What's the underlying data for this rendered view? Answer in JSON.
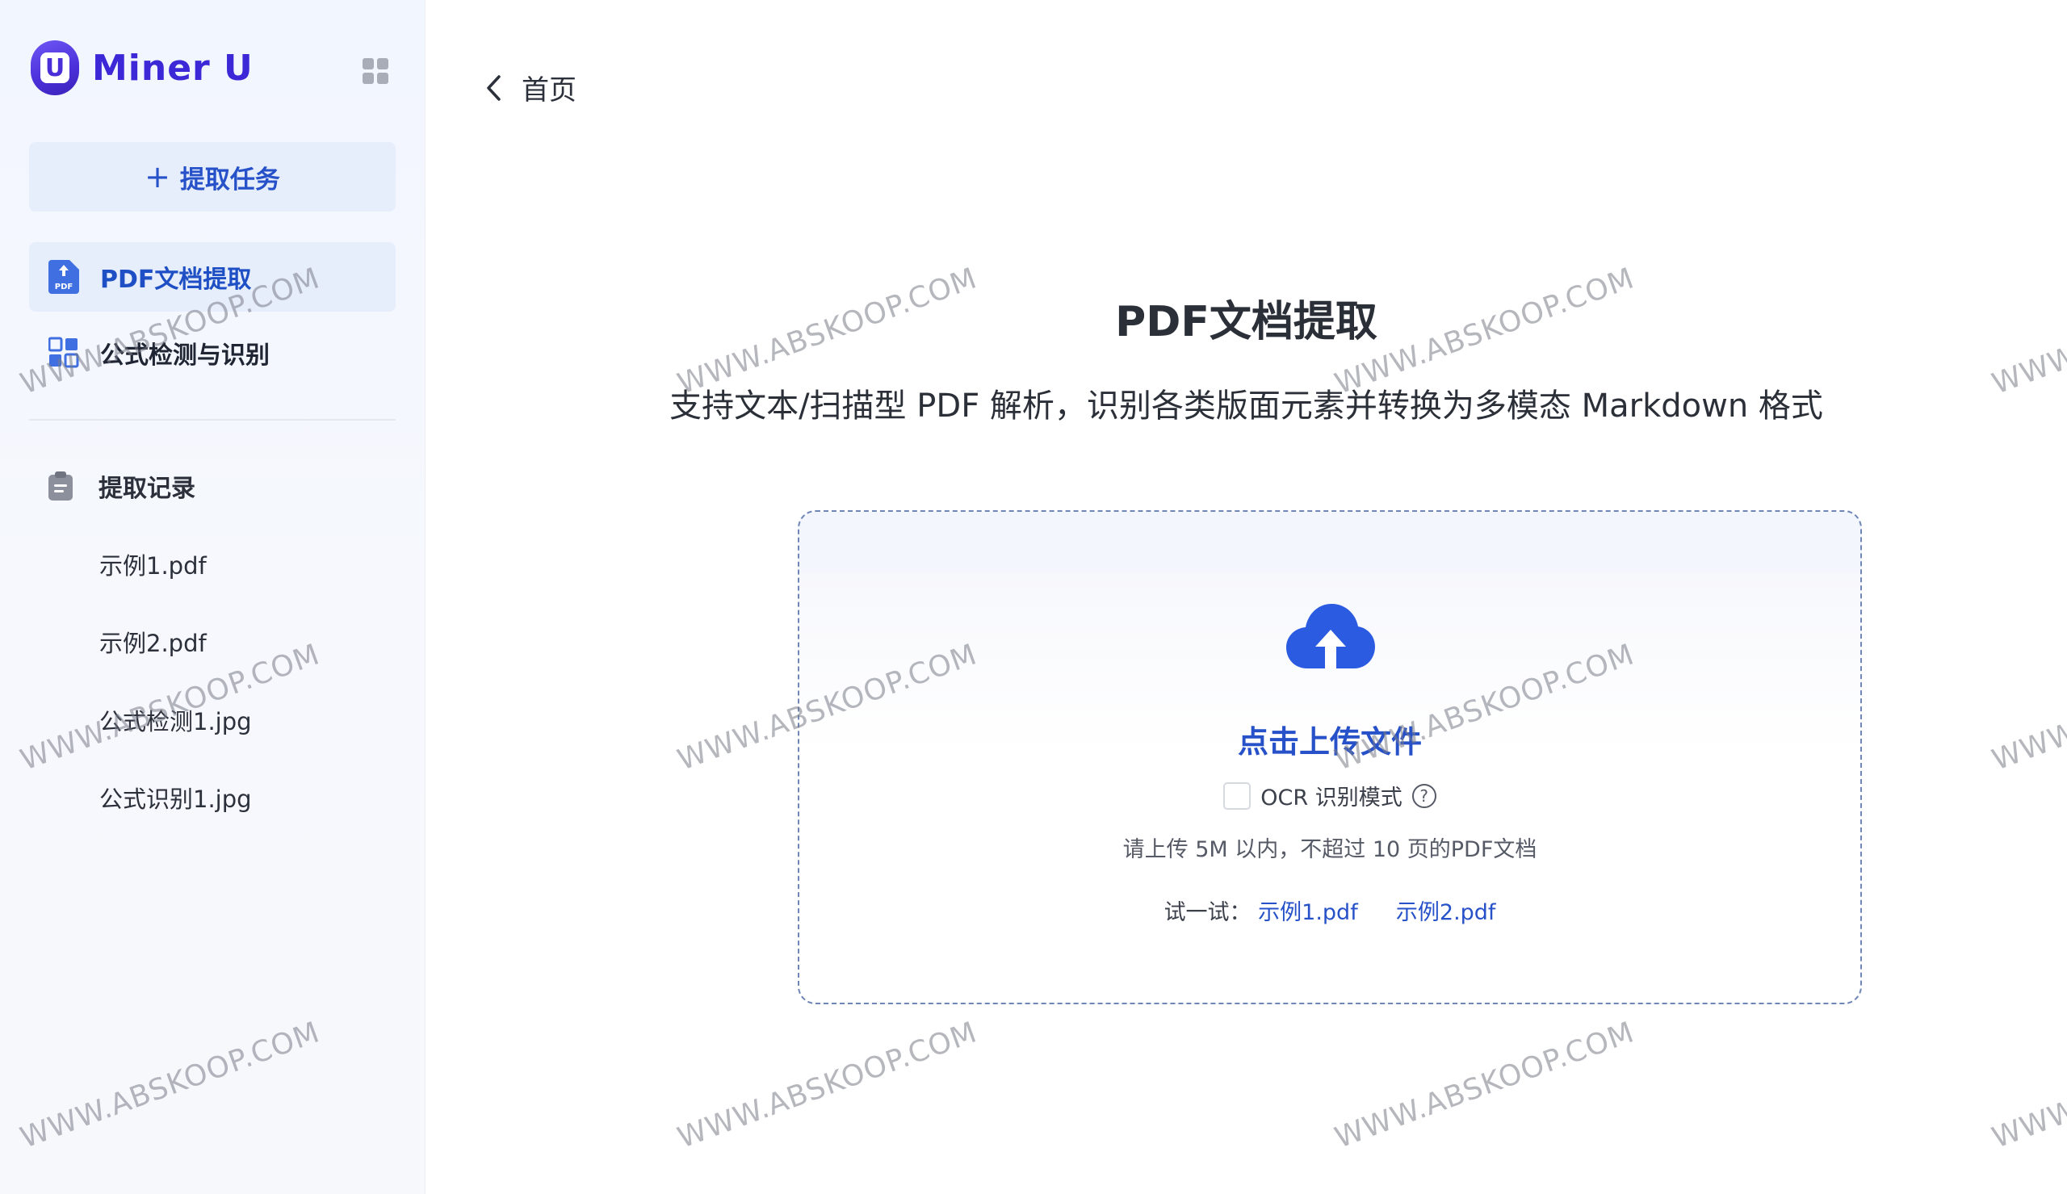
{
  "app": {
    "logo_mark": "U",
    "logo_text": "Miner U"
  },
  "sidebar": {
    "new_task_label": "提取任务",
    "nav": [
      {
        "label": "PDF文档提取",
        "icon": "pdf-doc-icon",
        "active": true
      },
      {
        "label": "公式检测与识别",
        "icon": "formula-grid-icon",
        "active": false
      }
    ],
    "history": {
      "title": "提取记录",
      "items": [
        "示例1.pdf",
        "示例2.pdf",
        "公式检测1.jpg",
        "公式识别1.jpg"
      ]
    }
  },
  "main": {
    "back_label": "首页",
    "title": "PDF文档提取",
    "subtitle": "支持文本/扫描型 PDF 解析，识别各类版面元素并转换为多模态 Markdown 格式",
    "upload": {
      "label": "点击上传文件",
      "ocr_label": "OCR 识别模式",
      "ocr_checked": false,
      "hint": "请上传 5M 以内，不超过 10 页的PDF文档",
      "try_prefix": "试一试：",
      "samples": [
        "示例1.pdf",
        "示例2.pdf"
      ]
    }
  },
  "watermark": "WWW.ABSKOOP.COM",
  "colors": {
    "accent": "#2651c8",
    "brand": "#3d28d8",
    "active_bg": "#e6edfb"
  }
}
